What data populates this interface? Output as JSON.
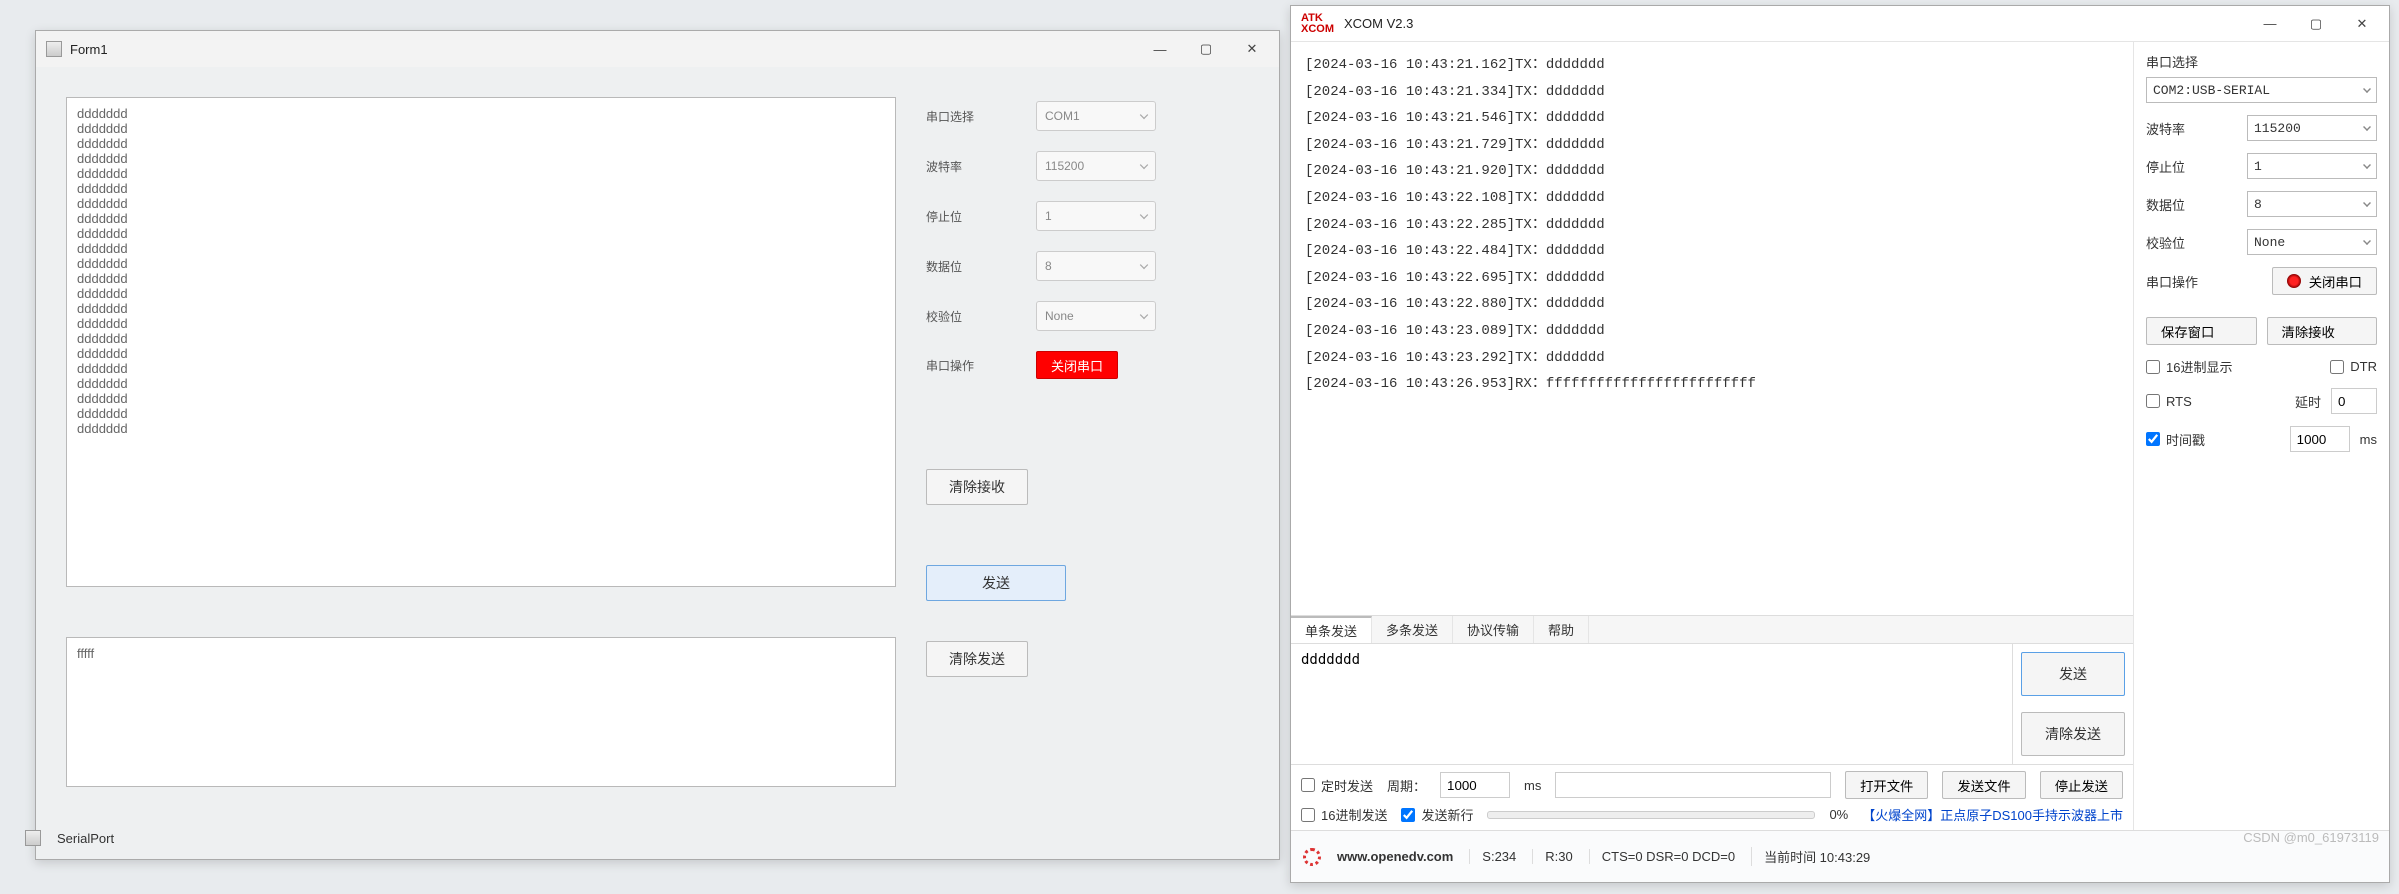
{
  "form1": {
    "title": "Form1",
    "rx_text": "ddddddd\nddddddd\nddddddd\nddddddd\nddddddd\nddddddd\nddddddd\nddddddd\nddddddd\nddddddd\nddddddd\nddddddd\nddddddd\nddddddd\nddddddd\nddddddd\nddddddd\nddddddd\nddddddd\nddddddd\nddddddd\nddddddd",
    "tx_text": "fffff",
    "labels": {
      "port": "串口选择",
      "baud": "波特率",
      "stopbits": "停止位",
      "databits": "数据位",
      "parity": "校验位",
      "portop": "串口操作"
    },
    "values": {
      "port": "COM1",
      "baud": "115200",
      "stopbits": "1",
      "databits": "8",
      "parity": "None"
    },
    "buttons": {
      "close_port": "关闭串口",
      "clear_rx": "清除接收",
      "send": "发送",
      "clear_tx": "清除发送"
    }
  },
  "xcom": {
    "title": "XCOM V2.3",
    "log_lines": [
      "[2024-03-16 10:43:21.162]TX：ddddddd",
      "[2024-03-16 10:43:21.334]TX：ddddddd",
      "[2024-03-16 10:43:21.546]TX：ddddddd",
      "[2024-03-16 10:43:21.729]TX：ddddddd",
      "[2024-03-16 10:43:21.920]TX：ddddddd",
      "[2024-03-16 10:43:22.108]TX：ddddddd",
      "[2024-03-16 10:43:22.285]TX：ddddddd",
      "[2024-03-16 10:43:22.484]TX：ddddddd",
      "[2024-03-16 10:43:22.695]TX：ddddddd",
      "[2024-03-16 10:43:22.880]TX：ddddddd",
      "[2024-03-16 10:43:23.089]TX：ddddddd",
      "[2024-03-16 10:43:23.292]TX：ddddddd",
      "[2024-03-16 10:43:26.953]RX：fffffffffffffffffffffffff"
    ],
    "tabs": [
      "单条发送",
      "多条发送",
      "协议传输",
      "帮助"
    ],
    "send_text": "ddddddd",
    "side": {
      "port_label": "串口选择",
      "port": "COM2:USB-SERIAL",
      "baud_label": "波特率",
      "baud": "115200",
      "stop_label": "停止位",
      "stop": "1",
      "data_label": "数据位",
      "data": "8",
      "parity_label": "校验位",
      "parity": "None",
      "op_label": "串口操作",
      "op_btn": "关闭串口",
      "save_window": "保存窗口",
      "clear_rx": "清除接收",
      "hex_show": "16进制显示",
      "dtr": "DTR",
      "rts": "RTS",
      "delay_label": "延时",
      "delay_val": "0",
      "ts_label": "时间戳",
      "ts_val": "1000",
      "ts_unit": "ms"
    },
    "toolbar": {
      "timed_send": "定时发送",
      "period_label": "周期：",
      "period_val": "1000",
      "period_unit": "ms",
      "hex_send": "16进制发送",
      "newline": "发送新行",
      "open_file": "打开文件",
      "send_file": "发送文件",
      "stop_send": "停止发送",
      "percent": "0%",
      "ad": "【火爆全网】正点原子DS100手持示波器上市"
    },
    "send_btn": "发送",
    "clear_send_btn": "清除发送",
    "status": {
      "url": "www.openedv.com",
      "s": "S:234",
      "r": "R:30",
      "cts": "CTS=0 DSR=0 DCD=0",
      "time_label": "当前时间 10:43:29"
    }
  },
  "taskbar": {
    "item": "SerialPort"
  },
  "watermark": "CSDN @m0_61973119"
}
